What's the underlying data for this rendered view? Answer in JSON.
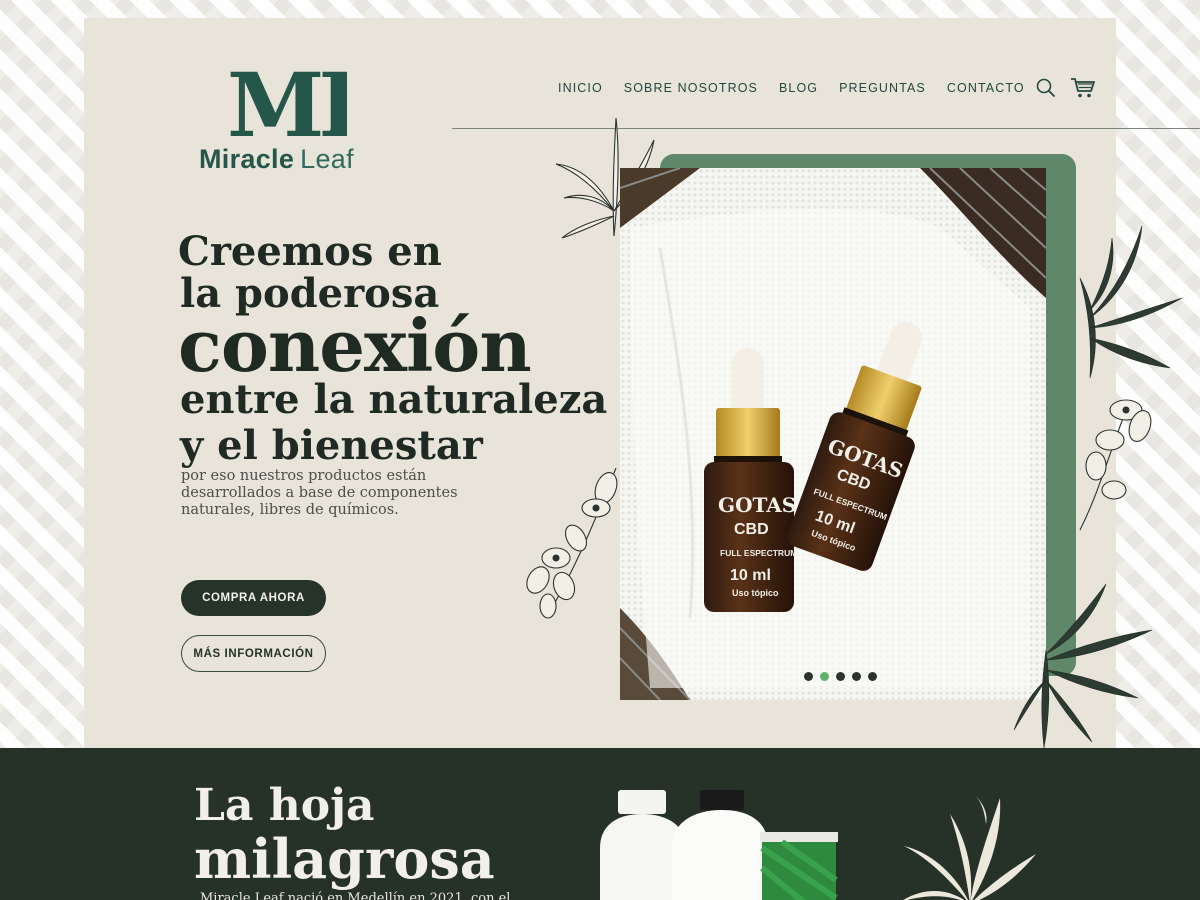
{
  "brand": {
    "logo_letters": "ML",
    "name_part1": "Miracle",
    "name_part2": "Leaf"
  },
  "nav": {
    "items": [
      {
        "label": "INICIO"
      },
      {
        "label": "SOBRE NOSOTROS"
      },
      {
        "label": "BLOG"
      },
      {
        "label": "PREGUNTAS"
      },
      {
        "label": "CONTACTO"
      }
    ],
    "icons": [
      "search-icon",
      "cart-icon"
    ]
  },
  "hero": {
    "title_line1": "Creemos en",
    "title_line2": "la poderosa",
    "title_emphasis": "conexión",
    "title_line4": "entre la naturaleza",
    "title_line5": "y el bienestar",
    "subtitle": "por eso nuestros productos están desarrollados a base de componentes naturales, libres de químicos.",
    "primary_button": "COMPRA AHORA",
    "secondary_button": "MÁS INFORMACIÓN"
  },
  "product_photo": {
    "label_brand": "GOTAS",
    "label_product": "CBD",
    "label_type": "FULL ESPECTRUM",
    "label_volume": "10 ml",
    "label_use": "Uso tópico"
  },
  "carousel": {
    "slide_count": 5,
    "active_index": 1
  },
  "section2": {
    "title_line1": "La hoja",
    "title_line2": "milagrosa",
    "paragraph_partial": "Miracle Leaf nació en Medellín en 2021, con el"
  },
  "colors": {
    "cream": "#e8e4da",
    "dark_green": "#263127",
    "brand_teal": "#24564a",
    "accent_green": "#5e8869",
    "active_dot": "#5eb16e"
  }
}
